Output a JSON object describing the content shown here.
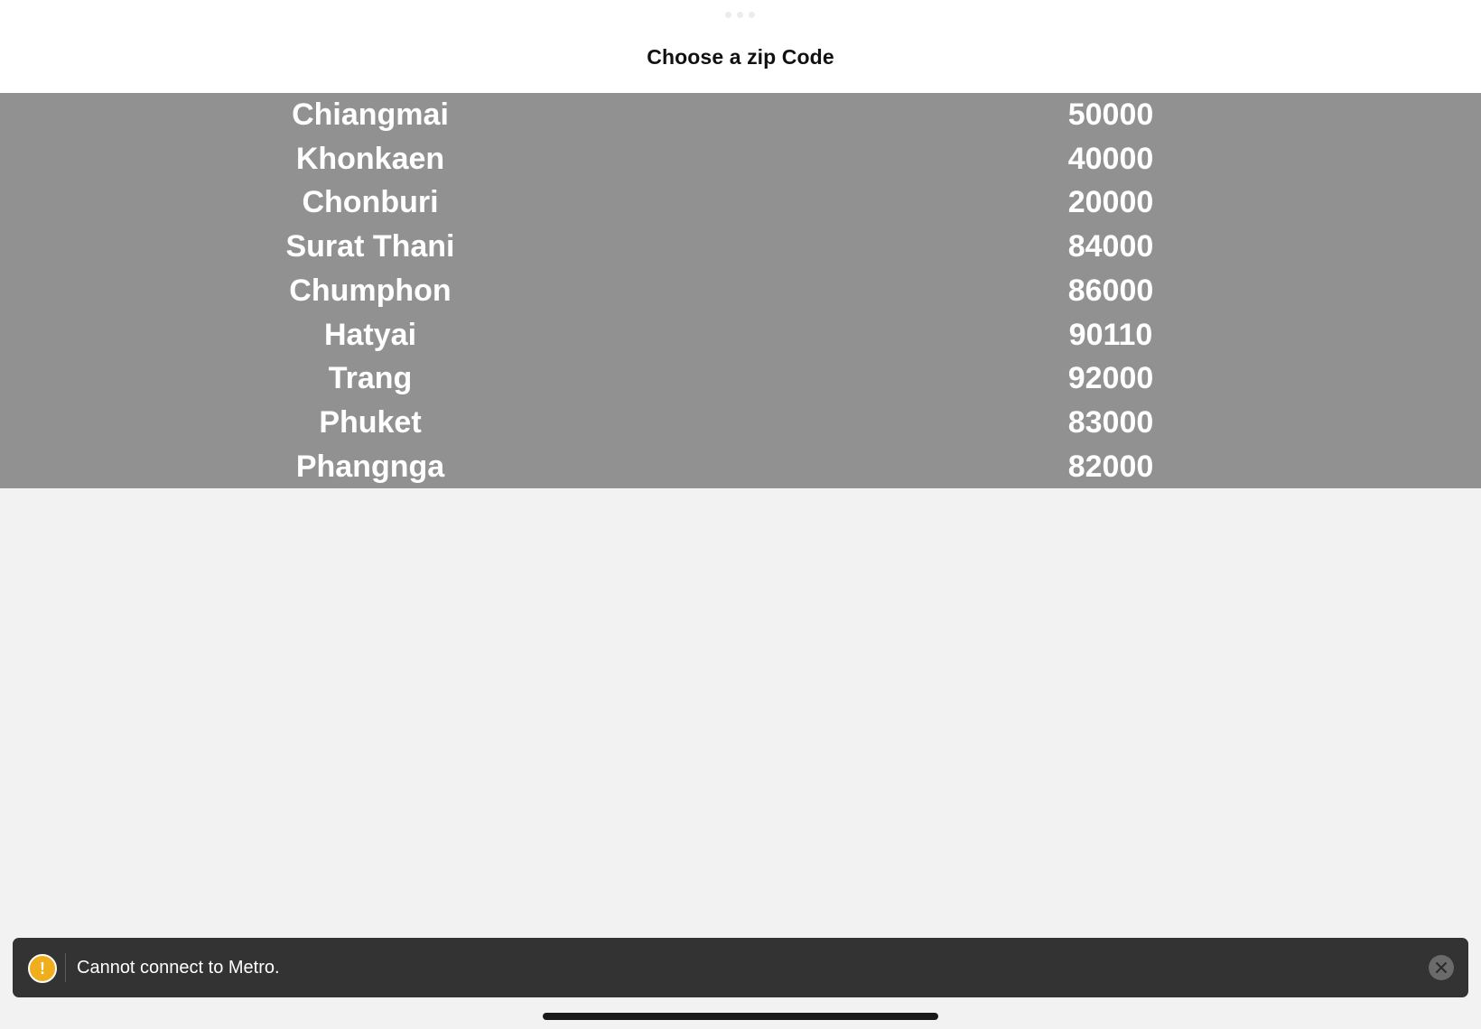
{
  "header": {
    "title": "Choose a zip Code"
  },
  "zip_list": [
    {
      "city": "Chiangmai",
      "zip": "50000"
    },
    {
      "city": "Khonkaen",
      "zip": "40000"
    },
    {
      "city": "Chonburi",
      "zip": "20000"
    },
    {
      "city": "Surat Thani",
      "zip": "84000"
    },
    {
      "city": "Chumphon",
      "zip": "86000"
    },
    {
      "city": "Hatyai",
      "zip": "90110"
    },
    {
      "city": "Trang",
      "zip": "92000"
    },
    {
      "city": "Phuket",
      "zip": "83000"
    },
    {
      "city": "Phangnga",
      "zip": "82000"
    }
  ],
  "toast": {
    "message": "Cannot connect to Metro.",
    "icon": "warning-icon",
    "icon_glyph": "!",
    "close_icon": "close-icon"
  },
  "colors": {
    "list_background": "#919191",
    "toast_background": "#333333",
    "warning": "#f0ad1c"
  }
}
